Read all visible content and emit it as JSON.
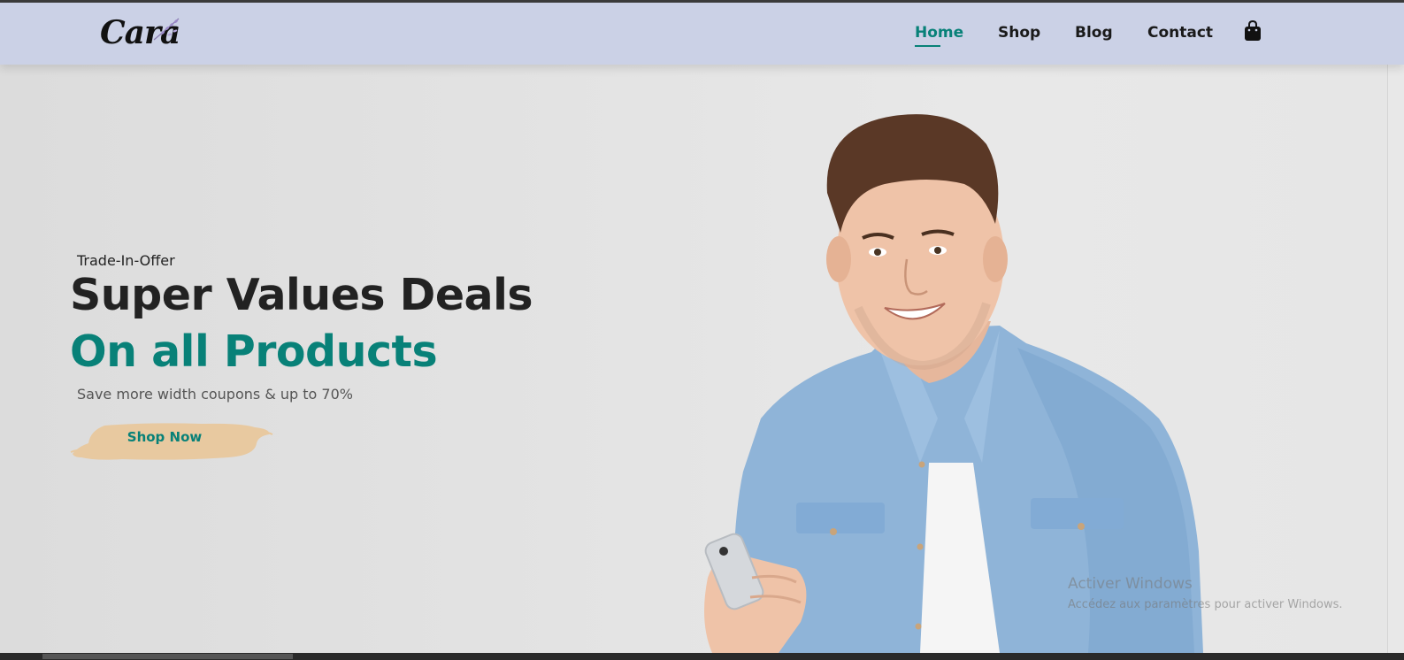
{
  "brand": {
    "logo_text": "Cara"
  },
  "nav": {
    "items": [
      {
        "label": "Home",
        "active": true
      },
      {
        "label": "Shop",
        "active": false
      },
      {
        "label": "Blog",
        "active": false
      },
      {
        "label": "Contact",
        "active": false
      }
    ],
    "cart_icon": "shopping-bag-icon"
  },
  "hero": {
    "eyebrow": "Trade-In-Offer",
    "headline": "Super Values Deals",
    "subheadline": "On all Products",
    "description": "Save more width coupons & up to 70%",
    "cta_label": "Shop Now"
  },
  "os_watermark": {
    "title": "Activer Windows",
    "subtitle": "Accédez aux paramètres pour activer Windows."
  },
  "colors": {
    "accent": "#088178",
    "navbar_bg": "#cbd1e6",
    "cta_brush": "#e8c9a0",
    "headline": "#222222"
  }
}
